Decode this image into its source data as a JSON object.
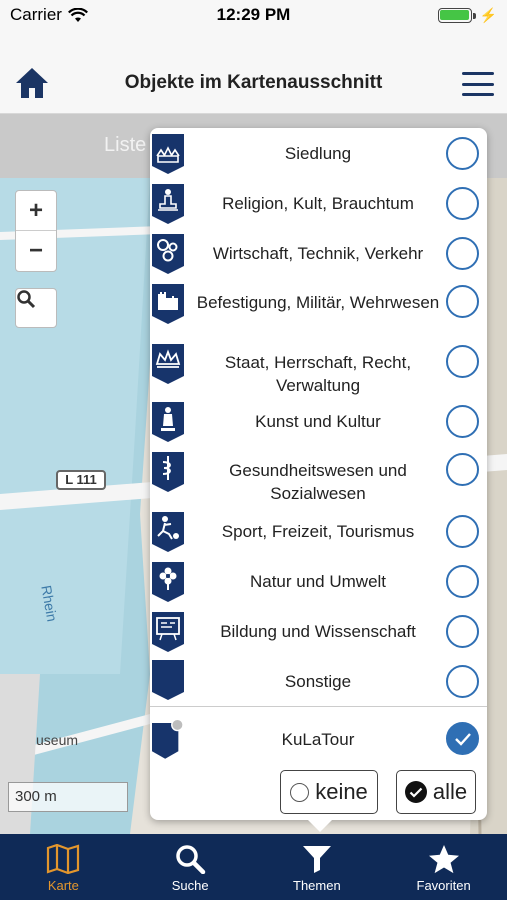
{
  "status": {
    "carrier": "Carrier",
    "time": "12:29 PM"
  },
  "nav": {
    "title": "Objekte im Kartenausschnitt"
  },
  "map": {
    "list_label": "Liste",
    "road_label": "L 111",
    "river_label": "Rhein",
    "poi_label": "useum",
    "scale_label": "300 m",
    "zoom_in": "+",
    "zoom_out": "−"
  },
  "popover": {
    "categories": [
      {
        "label": "Siedlung",
        "icon": "settlement-icon",
        "selected": false
      },
      {
        "label": "Religion, Kult, Brauchtum",
        "icon": "religion-icon",
        "selected": false
      },
      {
        "label": "Wirtschaft, Technik, Verkehr",
        "icon": "gears-icon",
        "selected": false
      },
      {
        "label": "Befestigung, Militär, Wehrwesen",
        "icon": "fortress-icon",
        "selected": false
      },
      {
        "label": "Staat, Herrschaft, Recht, Verwaltung",
        "icon": "crown-icon",
        "selected": false
      },
      {
        "label": "Kunst und Kultur",
        "icon": "statue-icon",
        "selected": false
      },
      {
        "label": "Gesundheitswesen und Sozialwesen",
        "icon": "caduceus-icon",
        "selected": false
      },
      {
        "label": "Sport, Freizeit, Tourismus",
        "icon": "soccer-icon",
        "selected": false
      },
      {
        "label": "Natur und Umwelt",
        "icon": "flower-icon",
        "selected": false
      },
      {
        "label": "Bildung und Wissenschaft",
        "icon": "blackboard-icon",
        "selected": false
      },
      {
        "label": "Sonstige",
        "icon": "blank-pin-icon",
        "selected": false
      }
    ],
    "kulatour": {
      "label": "KuLaTour",
      "selected": true
    },
    "none_label": "keine",
    "all_label": "alle"
  },
  "tabs": [
    {
      "label": "Karte",
      "icon": "map-icon",
      "active": true
    },
    {
      "label": "Suche",
      "icon": "search-icon",
      "active": false
    },
    {
      "label": "Themen",
      "icon": "funnel-icon",
      "active": false
    },
    {
      "label": "Favoriten",
      "icon": "star-icon",
      "active": false
    }
  ],
  "colors": {
    "accent": "#2f6fb4",
    "nav_dark": "#0f2a57",
    "tab_active": "#e3962d",
    "pin": "#17346b"
  }
}
